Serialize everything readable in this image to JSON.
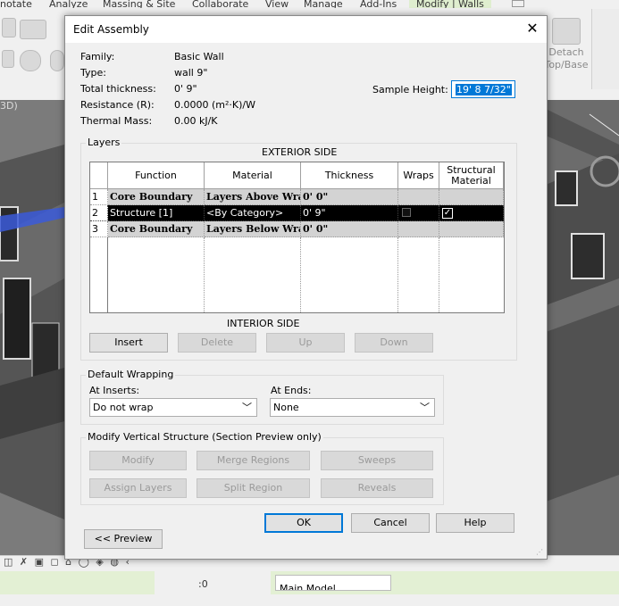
{
  "ribbon": {
    "tabs": [
      "notate",
      "Analyze",
      "Massing & Site",
      "Collaborate",
      "View",
      "Manage",
      "Add-Ins",
      "Modify | Walls"
    ],
    "detach_label_1": "Detach",
    "detach_label_2": "Top/Base"
  },
  "viewport": {
    "view_label": "3D)"
  },
  "statusbar": {
    "zero_value": ":0",
    "model_label": "Main Model"
  },
  "dialog": {
    "title": "Edit Assembly",
    "close_icon": "close-icon",
    "properties": [
      {
        "label": "Family:",
        "value": "Basic Wall"
      },
      {
        "label": "Type:",
        "value": "wall 9\""
      },
      {
        "label": "Total thickness:",
        "value": "0'  9\""
      },
      {
        "label": "Resistance (R):",
        "value": "0.0000 (m²·K)/W"
      },
      {
        "label": "Thermal Mass:",
        "value": "0.00 kJ/K"
      }
    ],
    "sample_height": {
      "label": "Sample Height:",
      "value": "19'  8 7/32\""
    },
    "layers": {
      "group_title": "Layers",
      "exterior_label": "EXTERIOR SIDE",
      "interior_label": "INTERIOR SIDE",
      "columns": [
        "Function",
        "Material",
        "Thickness",
        "Wraps",
        "Structural Material"
      ],
      "rows": [
        {
          "num": "1",
          "function": "Core Boundary",
          "material": "Layers Above Wra",
          "thickness": "0'  0\"",
          "wraps": false,
          "structural": false
        },
        {
          "num": "2",
          "function": "Structure [1]",
          "material": "<By Category>",
          "thickness": "0'  9\"",
          "wraps": false,
          "structural": true
        },
        {
          "num": "3",
          "function": "Core Boundary",
          "material": "Layers Below Wra",
          "thickness": "0'  0\"",
          "wraps": false,
          "structural": false
        }
      ],
      "buttons": {
        "insert": "Insert",
        "delete": "Delete",
        "up": "Up",
        "down": "Down"
      }
    },
    "default_wrapping": {
      "group_title": "Default Wrapping",
      "at_inserts_label": "At Inserts:",
      "at_inserts_value": "Do not wrap",
      "at_ends_label": "At Ends:",
      "at_ends_value": "None"
    },
    "vertical_structure": {
      "group_title": "Modify Vertical Structure (Section Preview only)",
      "buttons": {
        "modify": "Modify",
        "merge_regions": "Merge Regions",
        "sweeps": "Sweeps",
        "assign_layers": "Assign Layers",
        "split_region": "Split Region",
        "reveals": "Reveals"
      }
    },
    "footer": {
      "ok": "OK",
      "cancel": "Cancel",
      "help": "Help",
      "preview": "<< Preview"
    }
  }
}
